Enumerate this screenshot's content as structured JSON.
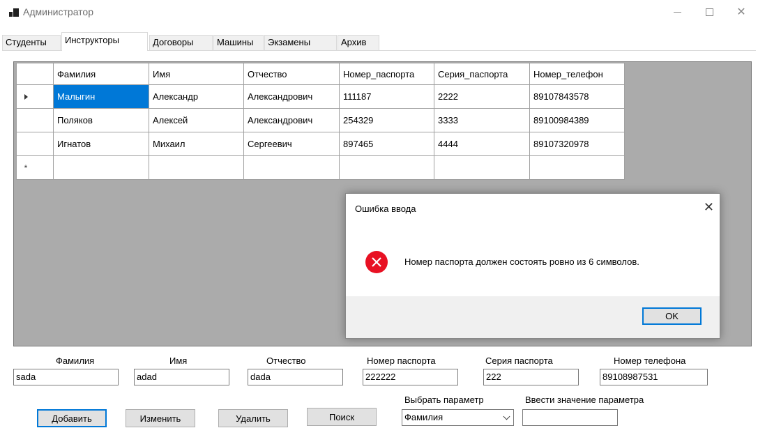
{
  "window": {
    "title": "Администратор"
  },
  "tabs": [
    {
      "label": "Студенты",
      "active": false
    },
    {
      "label": "Инструкторы",
      "active": true
    },
    {
      "label": "Договоры",
      "active": false
    },
    {
      "label": "Машины",
      "active": false
    },
    {
      "label": "Экзамены",
      "active": false
    },
    {
      "label": "Архив",
      "active": false
    }
  ],
  "grid": {
    "columns": [
      "Фамилия",
      "Имя",
      "Отчество",
      "Номер_паспорта",
      "Серия_паспорта",
      "Номер_телефон"
    ],
    "rows": [
      [
        "Малыгин",
        "Александр",
        "Александрович",
        "111187",
        "2222",
        "89107843578"
      ],
      [
        "Поляков",
        "Алексей",
        "Александрович",
        "254329",
        "3333",
        "89100984389"
      ],
      [
        "Игнатов",
        "Михаил",
        "Сергеевич",
        "897465",
        "4444",
        "89107320978"
      ]
    ],
    "new_row_marker": "*"
  },
  "form": {
    "labels": {
      "lastname": "Фамилия",
      "firstname": "Имя",
      "patronymic": "Отчество",
      "passport_number": "Номер паспорта",
      "passport_series": "Серия паспорта",
      "phone": "Номер телефона",
      "choose_param": "Выбрать параметр",
      "enter_value": "Ввести значение параметра"
    },
    "values": {
      "lastname": "sada",
      "firstname": "adad",
      "patronymic": "dada",
      "passport_number": "222222",
      "passport_series": "222",
      "phone": "89108987531",
      "param_selected": "Фамилия",
      "param_value": ""
    },
    "buttons": {
      "add": "Добавить",
      "edit": "Изменить",
      "delete": "Удалить",
      "search": "Поиск"
    }
  },
  "dialog": {
    "title": "Ошибка ввода",
    "message": "Номер паспорта должен состоять ровно из 6 символов.",
    "ok": "OK",
    "close": "✕"
  },
  "colors": {
    "selection": "#0078d7",
    "error": "#e81123",
    "grid_background": "#ababab"
  }
}
